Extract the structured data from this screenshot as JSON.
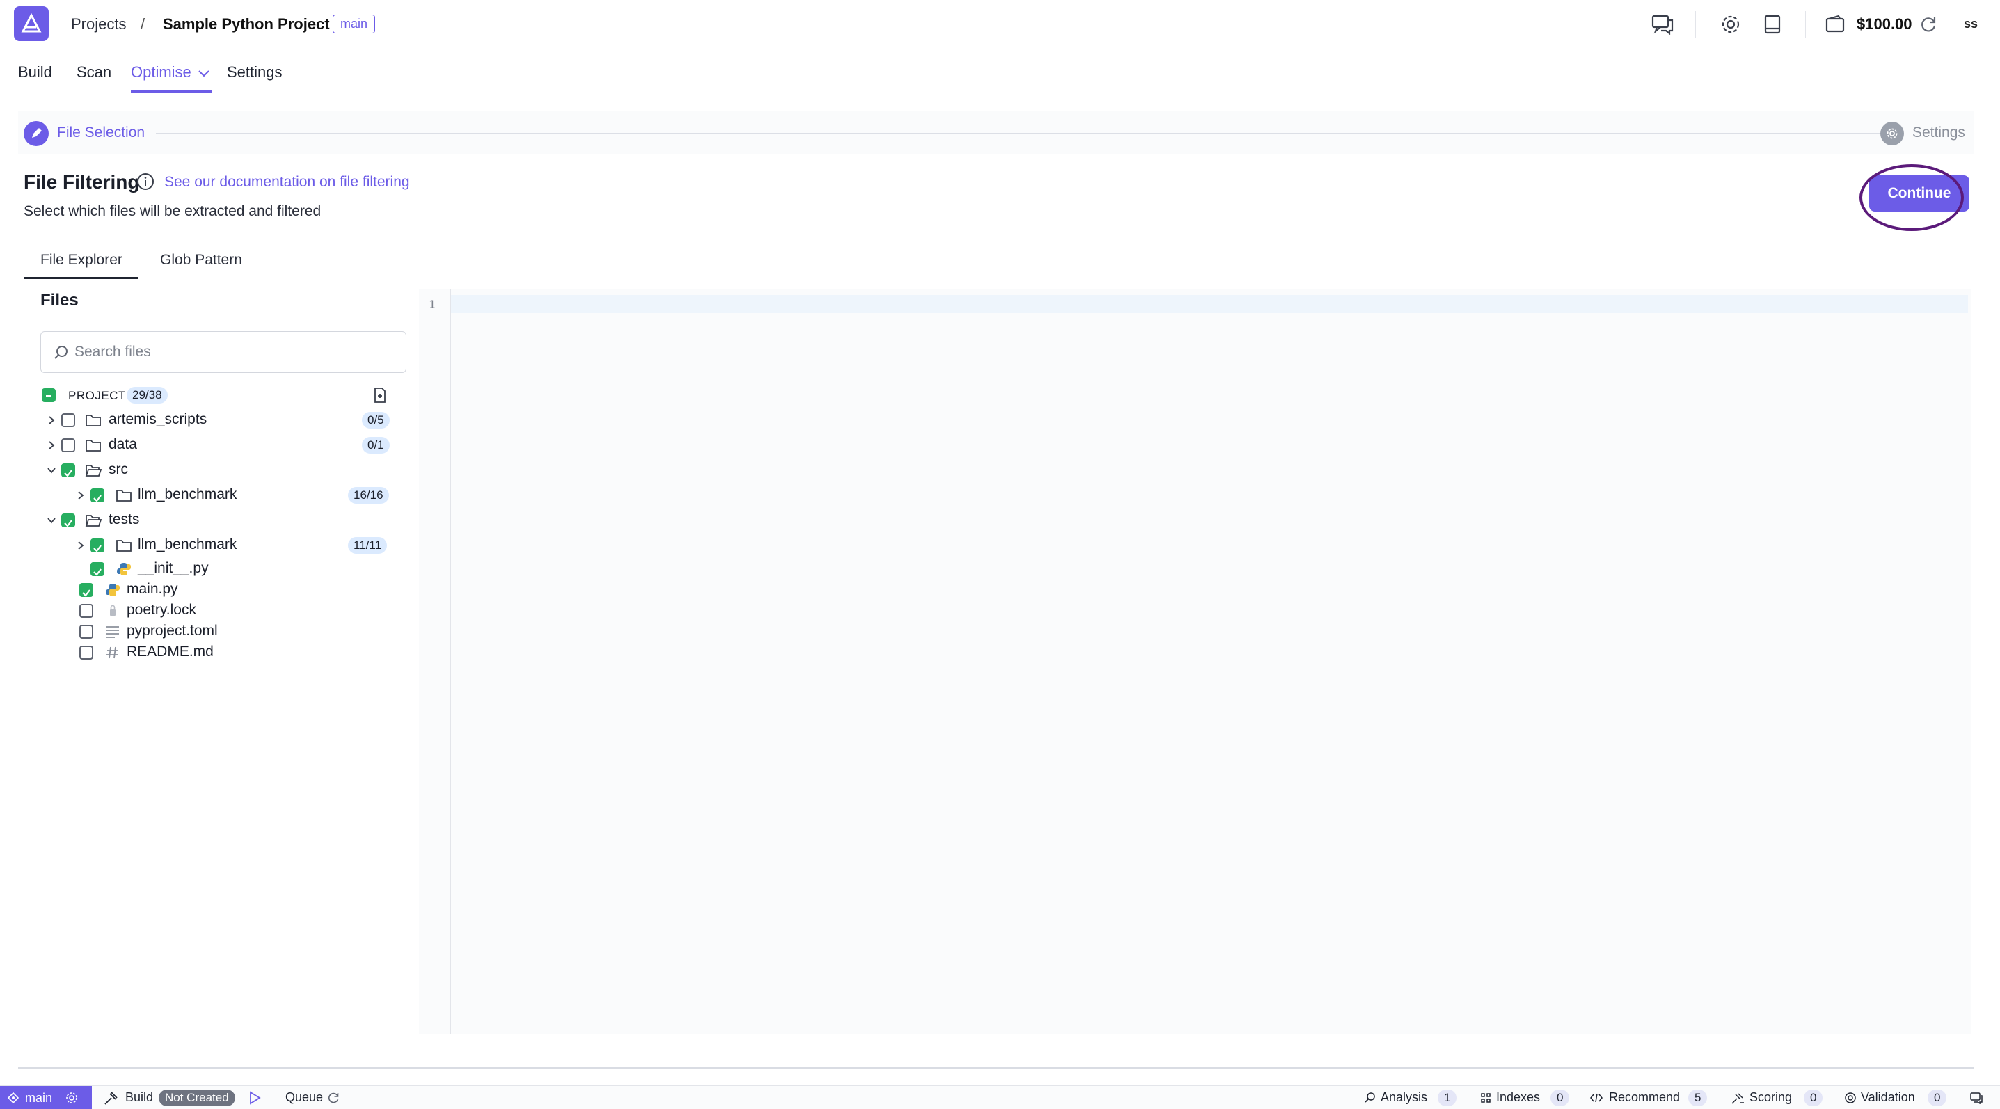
{
  "header": {
    "breadcrumb_projects": "Projects",
    "breadcrumb_separator": "/",
    "project_name": "Sample Python Project",
    "branch": "main",
    "wallet_amount": "$100.00",
    "user_initials": "ss",
    "icons": [
      "chat-icon",
      "settings-gear-icon",
      "book-icon",
      "wallet-icon",
      "refresh-icon"
    ]
  },
  "nav": {
    "tabs": [
      {
        "label": "Build"
      },
      {
        "label": "Scan"
      },
      {
        "label": "Optimise"
      },
      {
        "label": "Settings"
      }
    ],
    "active": "Optimise"
  },
  "stepper": {
    "step1": "File Selection",
    "step2": "Settings"
  },
  "filtering": {
    "title": "File Filtering",
    "doc_link": "See our documentation on file filtering",
    "subtitle": "Select which files will be extracted and filtered",
    "continue_label": "Continue"
  },
  "subtabs": {
    "file_explorer": "File Explorer",
    "glob_pattern": "Glob Pattern"
  },
  "files": {
    "title": "Files",
    "search_placeholder": "Search files",
    "project_label": "PROJECT",
    "project_count": "29/38",
    "tree": [
      {
        "name": "artemis_scripts",
        "type": "folder",
        "checked": false,
        "count": "0/5"
      },
      {
        "name": "data",
        "type": "folder",
        "checked": false,
        "count": "0/1"
      },
      {
        "name": "src",
        "type": "folder-open",
        "checked": true,
        "count": ""
      },
      {
        "name": "llm_benchmark",
        "type": "folder",
        "checked": true,
        "count": "16/16"
      },
      {
        "name": "tests",
        "type": "folder-open",
        "checked": true,
        "count": ""
      },
      {
        "name": "llm_benchmark",
        "type": "folder",
        "checked": true,
        "count": "11/11"
      },
      {
        "name": "__init__.py",
        "type": "python",
        "checked": true,
        "count": ""
      },
      {
        "name": "main.py",
        "type": "python",
        "checked": true,
        "count": ""
      },
      {
        "name": "poetry.lock",
        "type": "lock",
        "checked": false,
        "count": ""
      },
      {
        "name": "pyproject.toml",
        "type": "text",
        "checked": false,
        "count": ""
      },
      {
        "name": "README.md",
        "type": "markdown",
        "checked": false,
        "count": ""
      }
    ]
  },
  "editor": {
    "line_number": "1"
  },
  "statusbar": {
    "branch": "main",
    "build_label": "Build",
    "build_status": "Not Created",
    "queue_label": "Queue",
    "analysis_label": "Analysis",
    "analysis_count": "1",
    "indexes_label": "Indexes",
    "indexes_count": "0",
    "recommend_label": "Recommend",
    "recommend_count": "5",
    "scoring_label": "Scoring",
    "scoring_count": "0",
    "validation_label": "Validation",
    "validation_count": "0"
  },
  "colors": {
    "accent": "#6c5ce7",
    "checked": "#27ae60",
    "count_badge": "#dbeafe",
    "annotation_ring": "#5b1a7a"
  }
}
